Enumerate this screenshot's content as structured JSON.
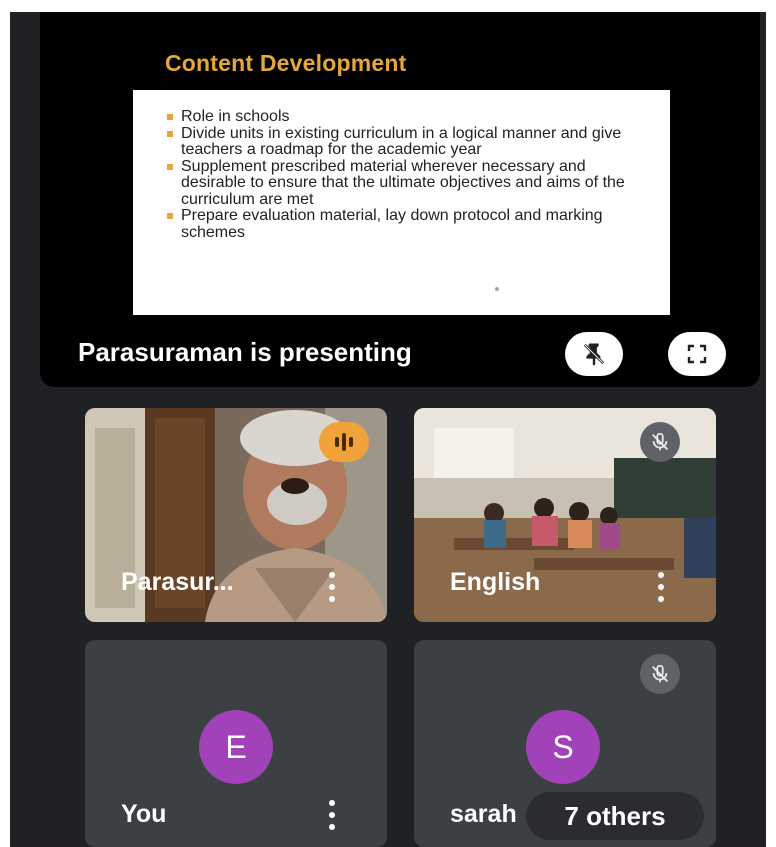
{
  "presentation": {
    "slide_title": "Content Development",
    "slide_bullets": [
      "Role in schools",
      "Divide units in existing curriculum in a logical manner and give teachers a roadmap for the academic year",
      "Supplement prescribed material wherever necessary and desirable to ensure that the ultimate objectives and aims of the curriculum are met",
      "Prepare evaluation material, lay down protocol and marking schemes"
    ],
    "presenting_label": "Parasuraman is presenting",
    "unpin_icon": "unpin-icon",
    "fullscreen_icon": "fullscreen-icon"
  },
  "participants": [
    {
      "name": "Parasur...",
      "status": "speaking"
    },
    {
      "name": "English",
      "status": "muted"
    },
    {
      "name": "You",
      "avatar_letter": "E"
    },
    {
      "name": "sarah",
      "avatar_letter": "S",
      "status": "muted"
    }
  ],
  "others_chip": "7 others",
  "colors": {
    "background": "#202124",
    "tile": "#3c4043",
    "avatar": "#a142b8",
    "slide_accent": "#e3a73a",
    "speaking_badge": "#f0a33a"
  }
}
